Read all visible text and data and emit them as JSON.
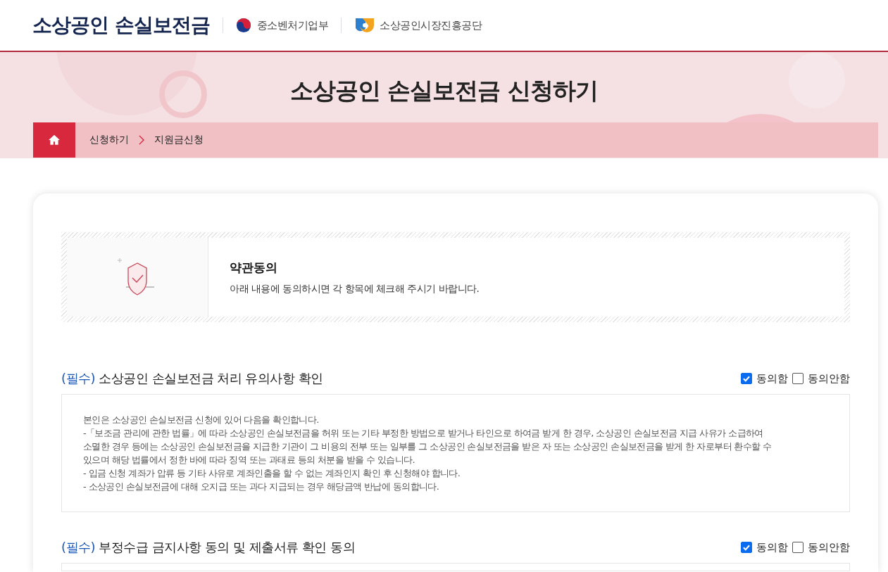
{
  "header": {
    "site_title": "소상공인 손실보전금",
    "ministry": "중소벤처기업부",
    "agency": "소상공인시장진흥공단"
  },
  "banner": {
    "title": "소상공인 손실보전금 신청하기"
  },
  "breadcrumb": [
    "신청하기",
    "지원금신청"
  ],
  "intro": {
    "title": "약관동의",
    "text": "아래 내용에 동의하시면 각 항목에 체크해 주시기 바랍니다."
  },
  "sections": [
    {
      "tag": "(필수)",
      "title": "소상공인 손실보전금 처리 유의사항 확인",
      "options": [
        {
          "label": "동의함",
          "checked": true
        },
        {
          "label": "동의안함",
          "checked": false
        }
      ],
      "lines": [
        "본인은 소상공인 손실보전금 신청에 있어 다음을 확인합니다.",
        "-「보조금 관리에 관한 법률」에 따라 소상공인 손실보전금을 허위 또는 기타 부정한 방법으로 받거나 타인으로 하여금 받게 한 경우, 소상공인 손실보전금 지급 사유가 소급하여",
        "소멸한 경우 등에는 소상공인 손실보전금을 지급한 기관이 그 비용의 전부 또는 일부를 그 소상공인 손실보전금을 받은 자 또는 소상공인 손실보전금을 받게 한 자로부터 환수할 수",
        "있으며 해당 법률에서 정한 바에 따라 징역 또는 과태료 등의 처분을 받을 수 있습니다.",
        "- 입금 신청 계좌가 압류 등 기타 사유로 계좌인출을 할 수 없는 계좌인지 확인 후 신청해야 합니다.",
        "- 소상공인 손실보전금에 대해 오지급 또는 과다 지급되는 경우 해당금액 반납에 동의합니다."
      ]
    },
    {
      "tag": "(필수)",
      "title": "부정수급 금지사항 동의 및 제출서류 확인 동의",
      "options": [
        {
          "label": "동의함",
          "checked": true
        },
        {
          "label": "동의안함",
          "checked": false
        }
      ]
    }
  ]
}
